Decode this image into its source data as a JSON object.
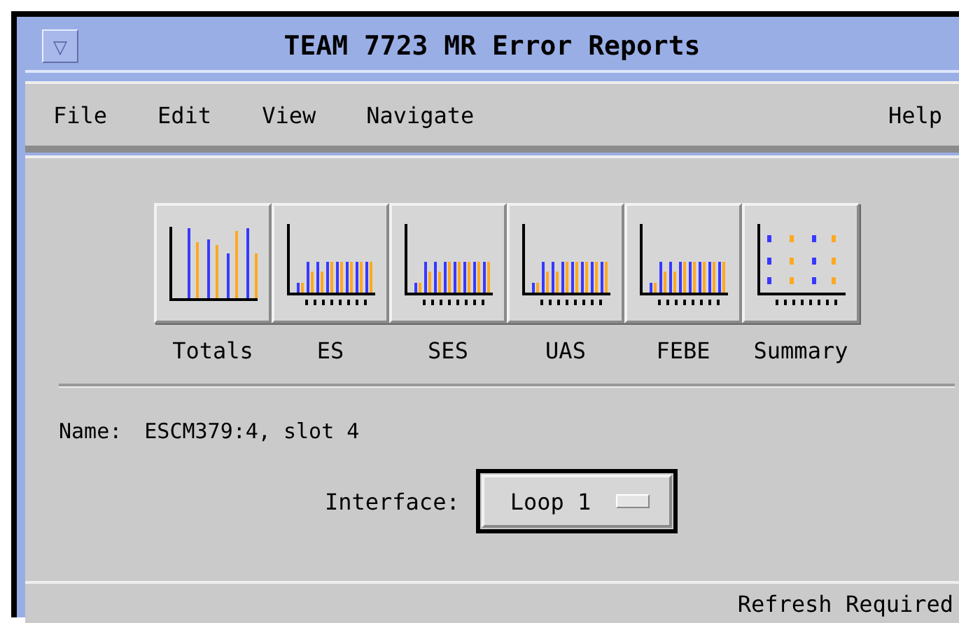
{
  "window": {
    "title": "TEAM 7723 MR Error Reports",
    "menu_button": "▽"
  },
  "menubar": {
    "left": [
      "File",
      "Edit",
      "View",
      "Navigate"
    ],
    "right": [
      "Help"
    ]
  },
  "report_buttons": [
    {
      "label": "Totals",
      "kind": "totals"
    },
    {
      "label": "ES",
      "kind": "series"
    },
    {
      "label": "SES",
      "kind": "series"
    },
    {
      "label": "UAS",
      "kind": "series"
    },
    {
      "label": "FEBE",
      "kind": "series"
    },
    {
      "label": "Summary",
      "kind": "summary"
    }
  ],
  "name_row": {
    "label": "Name:",
    "value": "ESCM379:4, slot 4"
  },
  "interface": {
    "label": "Interface:",
    "value": "Loop 1"
  },
  "status_bar": "Refresh Required"
}
